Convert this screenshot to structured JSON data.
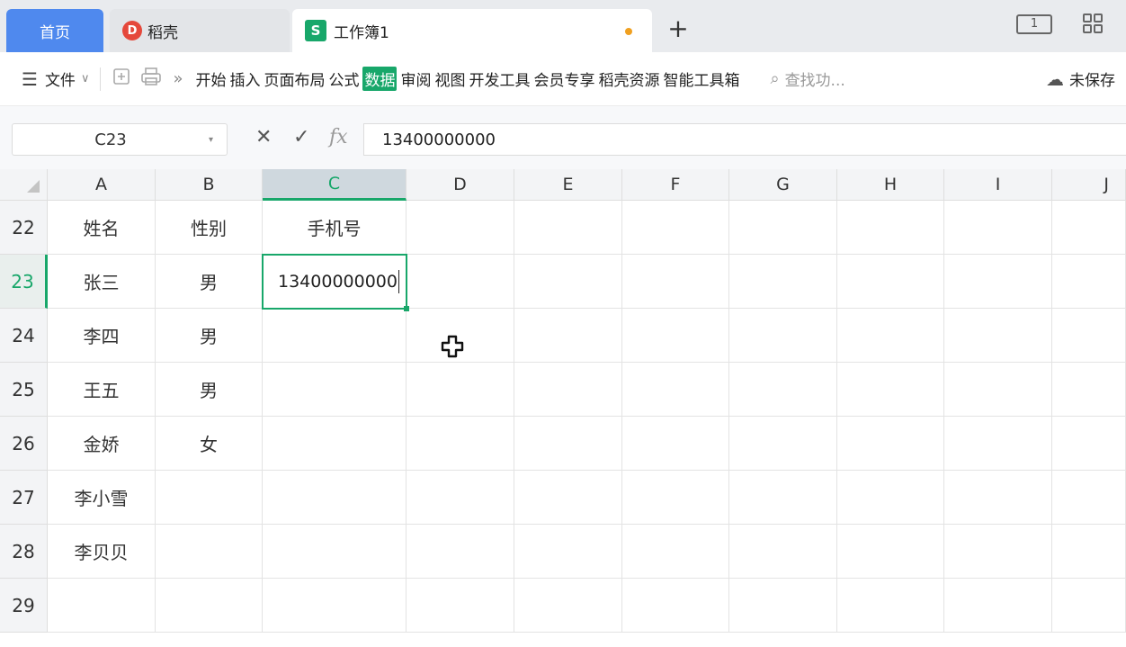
{
  "tabs": {
    "home": "首页",
    "docer": "稻壳",
    "docer_logo": "D",
    "workbook": "工作簿1",
    "workbook_logo": "S",
    "add": "+"
  },
  "window": {
    "layout_icon_text": "1"
  },
  "menu": {
    "hamburger": "☰",
    "file": "文件",
    "file_caret": "∨",
    "more": "»",
    "items": [
      "开始",
      "插入",
      "页面布局",
      "公式",
      "数据",
      "审阅",
      "视图",
      "开发工具",
      "会员专享",
      "稻壳资源",
      "智能工具箱"
    ],
    "active_item": "数据",
    "search_placeholder": "查找功...",
    "save_status": "未保存"
  },
  "formula_bar": {
    "cell_ref": "C23",
    "cancel": "✕",
    "confirm": "✓",
    "fx": "fx",
    "value": "13400000000"
  },
  "sheet": {
    "columns": [
      "A",
      "B",
      "C",
      "D",
      "E",
      "F",
      "G",
      "H",
      "I",
      "J"
    ],
    "selected_column": "C",
    "selected_row": "23",
    "rows": [
      {
        "num": "22",
        "A": "姓名",
        "B": "性别",
        "C": "手机号"
      },
      {
        "num": "23",
        "A": "张三",
        "B": "男",
        "C": "13400000000"
      },
      {
        "num": "24",
        "A": "李四",
        "B": "男",
        "C": ""
      },
      {
        "num": "25",
        "A": "王五",
        "B": "男",
        "C": ""
      },
      {
        "num": "26",
        "A": "金娇",
        "B": "女",
        "C": ""
      },
      {
        "num": "27",
        "A": "李小雪",
        "B": "",
        "C": ""
      },
      {
        "num": "28",
        "A": "李贝贝",
        "B": "",
        "C": ""
      },
      {
        "num": "29",
        "A": "",
        "B": "",
        "C": ""
      }
    ]
  },
  "colors": {
    "accent": "#18a76a",
    "home_tab": "#4f89ee"
  }
}
